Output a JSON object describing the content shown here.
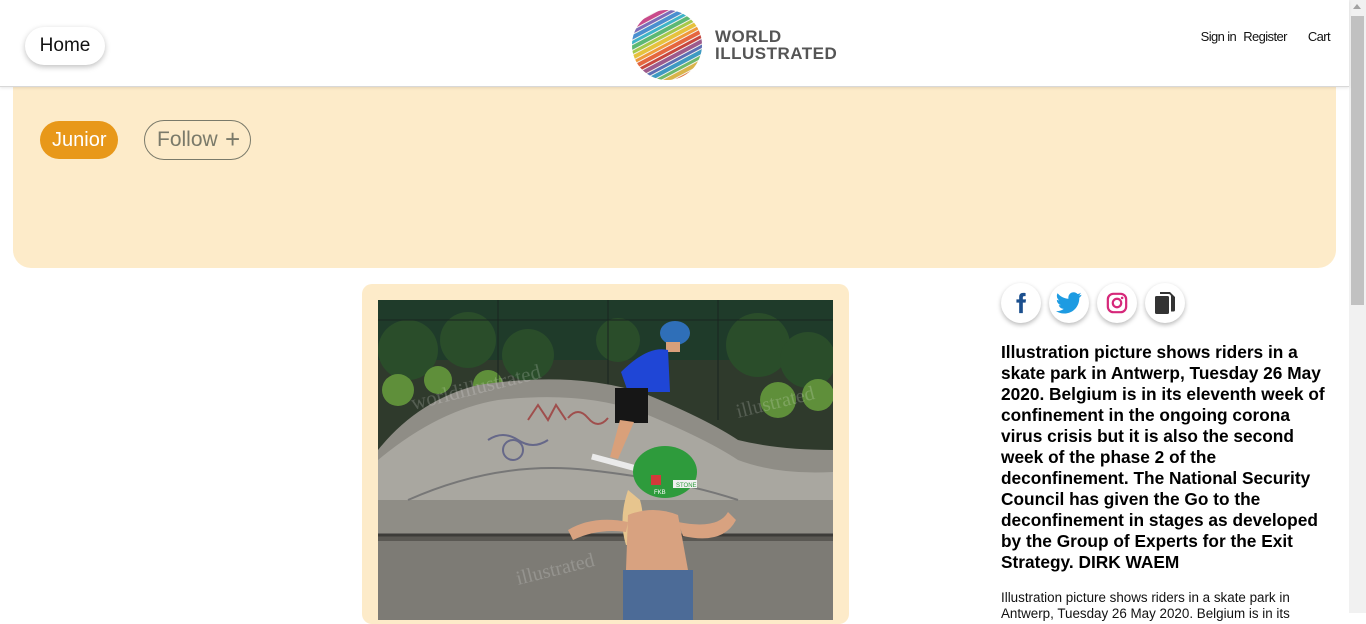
{
  "header": {
    "home_label": "Home",
    "logo_line1": "WORLD",
    "logo_line2": "ILLUSTRATED",
    "signin_label": "Sign in",
    "register_label": "Register",
    "cart_label": "Cart"
  },
  "topic": {
    "name": "Junior",
    "follow_label": "Follow",
    "follow_icon": "+",
    "accent_color": "#e8981a",
    "banner_color": "#fdebc9"
  },
  "share": {
    "icons": [
      "facebook-icon",
      "twitter-icon",
      "instagram-icon",
      "copy-icon"
    ],
    "facebook_color": "#1b4f8e",
    "twitter_color": "#1d9be2",
    "instagram_color": "#d6287a",
    "copy_color": "#333333"
  },
  "photo": {
    "watermark": "worldillustrated",
    "watermark_2": "illustrated",
    "watermark_3": "illustrated",
    "helmet_text_1": "STONE",
    "helmet_text_2": "FKB"
  },
  "caption": {
    "title": "Illustration picture shows riders in a skate park in Antwerp, Tuesday 26 May 2020. Belgium is in its eleventh week of confinement in the ongoing corona virus crisis but it is also the second week of the phase 2 of the deconfinement. The National Security Council has given the Go to the deconfinement in stages as developed by the Group of Experts for the Exit Strategy. DIRK WAEM",
    "body": "Illustration picture shows riders in a skate park in Antwerp, Tuesday 26 May 2020. Belgium is in its"
  }
}
